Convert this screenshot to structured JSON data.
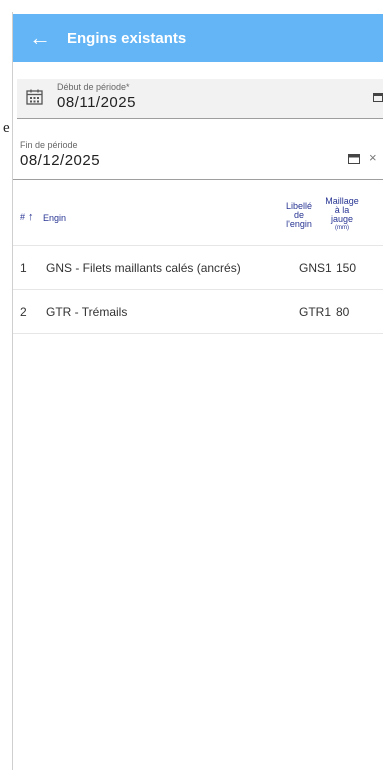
{
  "header": {
    "title": "Engins existants",
    "back_icon": "arrow-left-icon",
    "color": "#64b5f6"
  },
  "side_text": "e",
  "period_start": {
    "label": "Début de période*",
    "value": "08/11/2025"
  },
  "period_end": {
    "label": "Fin de période",
    "value": "08/12/2025",
    "clear": "×"
  },
  "table": {
    "columns": {
      "num": "#",
      "sort_arrow": "↑",
      "engin": "Engin",
      "libelle": [
        "Libellé",
        "de",
        "l'engin"
      ],
      "maillage": [
        "Maillage",
        "à la",
        "jauge",
        "(mm)"
      ]
    },
    "rows": [
      {
        "num": "1",
        "engin": "GNS - Filets maillants calés (ancrés)",
        "libelle": "GNS1",
        "maillage": "150"
      },
      {
        "num": "2",
        "engin": "GTR - Trémails",
        "libelle": "GTR1",
        "maillage": "80"
      }
    ]
  }
}
